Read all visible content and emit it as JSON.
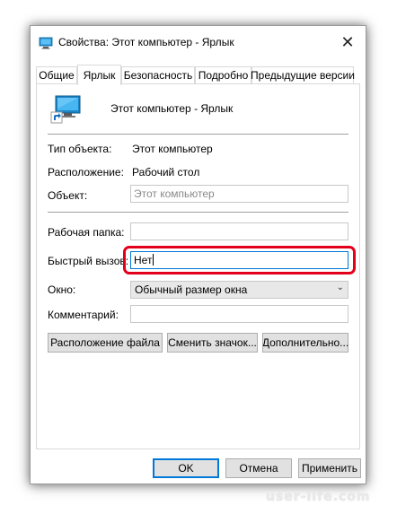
{
  "window": {
    "title": "Свойства: Этот компьютер - Ярлык",
    "close_glyph": "✕"
  },
  "tabs": [
    {
      "label": "Общие",
      "active": false
    },
    {
      "label": "Ярлык",
      "active": true
    },
    {
      "label": "Безопасность",
      "active": false
    },
    {
      "label": "Подробно",
      "active": false
    },
    {
      "label": "Предыдущие версии",
      "active": false
    }
  ],
  "shortcut": {
    "name": "Этот компьютер - Ярлык",
    "type_label": "Тип объекта:",
    "type_value": "Этот компьютер",
    "location_label": "Расположение:",
    "location_value": "Рабочий стол",
    "target_label": "Объект:",
    "target_value": "Этот компьютер",
    "workdir_label": "Рабочая папка:",
    "workdir_value": "",
    "hotkey_label": "Быстрый вызов:",
    "hotkey_value": "Нет",
    "window_label": "Окно:",
    "window_value": "Обычный размер окна",
    "comment_label": "Комментарий:",
    "comment_value": ""
  },
  "actions": {
    "open_location": "Расположение файла",
    "change_icon": "Сменить значок...",
    "advanced": "Дополнительно..."
  },
  "footer": {
    "ok": "OK",
    "cancel": "Отмена",
    "apply": "Применить"
  },
  "watermark": "user-life.com",
  "colors": {
    "highlight": "#e3001b",
    "focus": "#0078d7"
  }
}
